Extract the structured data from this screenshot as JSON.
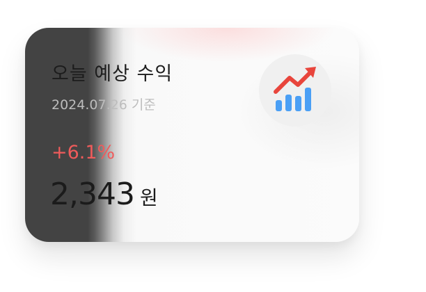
{
  "widget": {
    "title": "오늘 예상 수익",
    "date_label": "2024.07.26 기준",
    "change_percent": "+6.1%",
    "amount": "2,343",
    "currency_unit": "원",
    "icon": "chart-trending-up-icon"
  },
  "colors": {
    "positive_red": "#ef5b5b",
    "arrow_red": "#e8453c",
    "bar_blue": "#4a9ff5"
  }
}
